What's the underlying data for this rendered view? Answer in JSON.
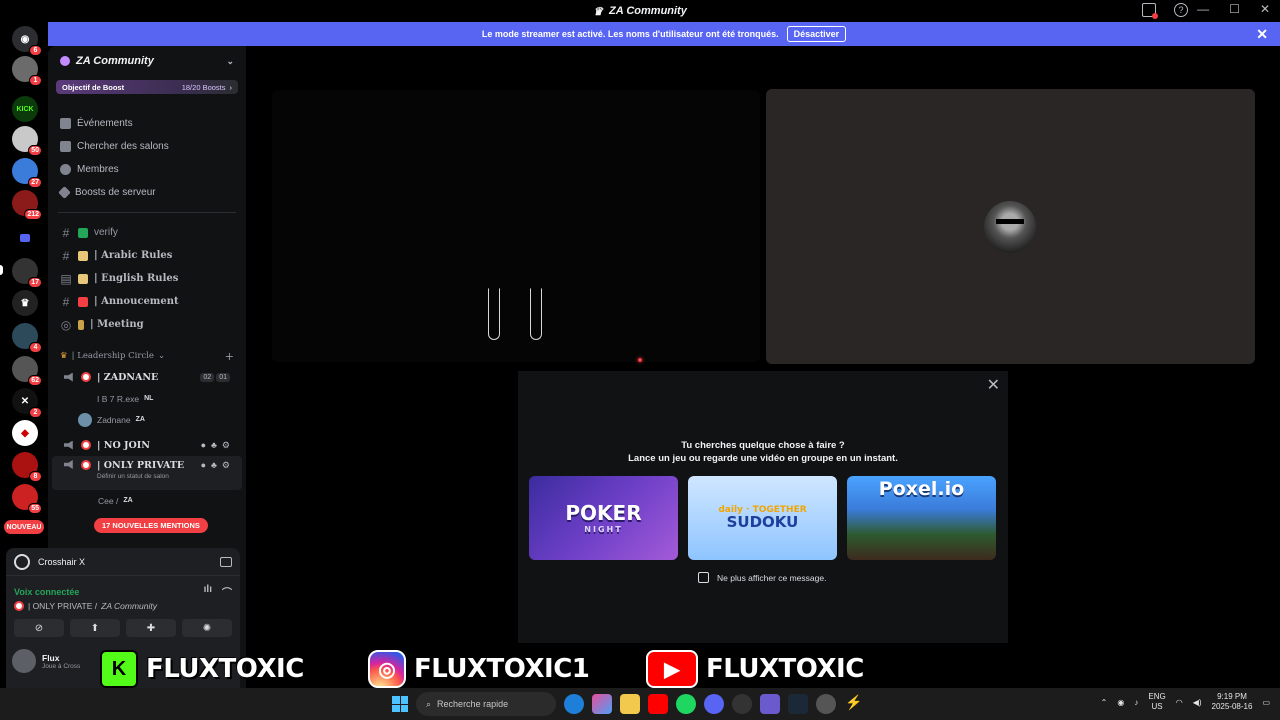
{
  "window": {
    "title": "ZA Community"
  },
  "banner": {
    "text": "Le mode streamer est activé. Les noms d'utilisateur ont été tronqués.",
    "button": "Désactiver"
  },
  "servers": [
    {
      "badge": "6"
    },
    {
      "badge": "1"
    },
    {
      "badge": ""
    },
    {
      "badge": "50"
    },
    {
      "badge": "27"
    },
    {
      "badge": "212"
    },
    {
      "badge": ""
    },
    {
      "badge": "17"
    },
    {
      "badge": ""
    },
    {
      "badge": "4"
    },
    {
      "badge": "62"
    },
    {
      "badge": "2"
    },
    {
      "badge": ""
    },
    {
      "badge": "8"
    },
    {
      "badge": "55"
    }
  ],
  "servers_new_label": "NOUVEAU",
  "sidebar": {
    "guild_name": "ZA Community",
    "boost_label": "Objectif de Boost",
    "boost_count": "18/20 Boosts",
    "menu": [
      "Événements",
      "Chercher des salons",
      "Membres",
      "Boosts de serveur"
    ],
    "channels": [
      {
        "name": "verify"
      },
      {
        "name": "| Arabic  Rules"
      },
      {
        "name": "| English  Rules"
      },
      {
        "name": "| Annoucement"
      },
      {
        "name": "| Meeting"
      }
    ],
    "category": "| Leadership Circle",
    "voice": {
      "zadnane": {
        "name": "| ZADNANE",
        "count_a": "02",
        "count_b": "01"
      },
      "users": [
        {
          "name": "I B 7 R.exe",
          "tag": "NL"
        },
        {
          "name": "Zadnane",
          "tag": "ZA"
        }
      ],
      "nojoin": {
        "name": "| NO JOIN"
      },
      "private": {
        "name": "| ONLY PRIVATE",
        "status": "Définir un statut de salon"
      },
      "private_user": {
        "name": "Cee /",
        "tag": "ZA"
      }
    },
    "mentions": "17 NOUVELLES MENTIONS"
  },
  "panel": {
    "activity": "Crosshair X",
    "voice_status": "Voix connectée",
    "voice_channel": "| ONLY PRIVATE / ",
    "voice_guild": "ZA Community",
    "user_name": "Flux",
    "user_sub": "Joue à Cross"
  },
  "popup": {
    "question": "Tu cherches quelque chose à faire ?",
    "sub": "Lance un jeu ou regarde une vidéo en groupe en un instant.",
    "cards": [
      {
        "title": "POKER",
        "sub": "NIGHT"
      },
      {
        "title": "SUDOKU",
        "sub": "daily · TOGETHER"
      },
      {
        "title": "Poxel.io",
        "sub": ""
      }
    ],
    "checkbox": "Ne plus afficher ce message."
  },
  "overlay": {
    "kick_logo": "K",
    "kick": "FLUXTOXIC",
    "insta": "FLUXTOXIC1",
    "youtube": "FLUXTOXIC"
  },
  "taskbar": {
    "search": "Recherche rapide",
    "lang_top": "ENG",
    "lang_bottom": "US",
    "time": "9:19 PM",
    "date": "2025-08-16"
  },
  "colors": {
    "blurple": "#5865f2",
    "red": "#f23f43",
    "green": "#23a55a",
    "kick": "#53fc18"
  }
}
